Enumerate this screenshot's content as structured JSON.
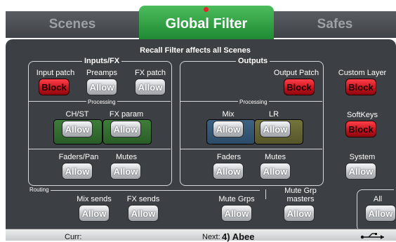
{
  "tabs": {
    "left": "Scenes",
    "active": "Global Filter",
    "right": "Safes"
  },
  "headline": "Recall Filter affects all Scenes",
  "inputs_fx": {
    "title": "Inputs/FX",
    "input_patch": {
      "label": "Input patch",
      "button": "Block"
    },
    "preamps": {
      "label": "Preamps",
      "button": "Allow"
    },
    "fx_patch": {
      "label": "FX patch",
      "button": "Allow"
    },
    "processing_title": "Processing",
    "ch_st": {
      "label": "CH/ST",
      "button": "Allow"
    },
    "fx_param": {
      "label": "FX param",
      "button": "Allow"
    },
    "faders_pan": {
      "label": "Faders/Pan",
      "button": "Allow"
    },
    "mutes": {
      "label": "Mutes",
      "button": "Allow"
    }
  },
  "outputs": {
    "title": "Outputs",
    "output_patch": {
      "label": "Output Patch",
      "button": "Block"
    },
    "processing_title": "Processing",
    "mix": {
      "label": "Mix",
      "button": "Allow"
    },
    "lr": {
      "label": "LR",
      "button": "Allow"
    },
    "faders": {
      "label": "Faders",
      "button": "Allow"
    },
    "mutes": {
      "label": "Mutes",
      "button": "Allow"
    }
  },
  "side": {
    "custom_layer": {
      "label": "Custom Layer",
      "button": "Block"
    },
    "softkeys": {
      "label": "SoftKeys",
      "button": "Block"
    },
    "system": {
      "label": "System",
      "button": "Allow"
    }
  },
  "routing": {
    "title": "Routing",
    "mix_sends": {
      "label": "Mix sends",
      "button": "Allow"
    },
    "fx_sends": {
      "label": "FX sends",
      "button": "Allow"
    },
    "mute_grps": {
      "label": "Mute Grps",
      "button": "Allow"
    },
    "mute_grp_masters": {
      "label_line1": "Mute Grp",
      "label_line2": "masters",
      "button": "Allow"
    }
  },
  "all": {
    "label": "All",
    "button": "Allow"
  },
  "status": {
    "curr": "Curr:",
    "next_prefix": "Next:",
    "next_scene": "4) Abee"
  },
  "icons": {
    "usb": "usb-icon"
  },
  "colors": {
    "active_tab": "#2f9e42",
    "block": "#d81e26",
    "panel": "#3c3f43"
  }
}
